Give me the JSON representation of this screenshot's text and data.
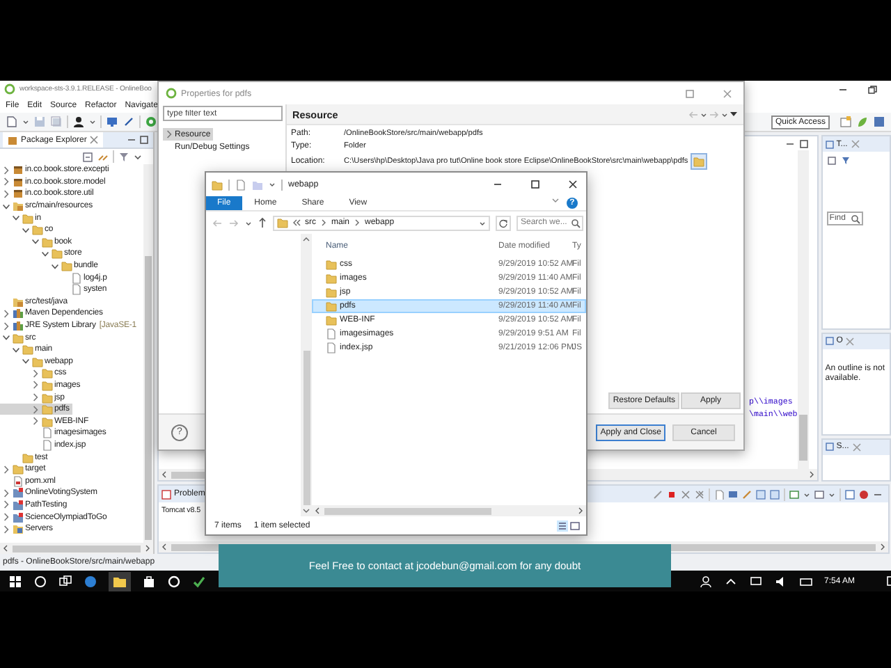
{
  "eclipse": {
    "title": "workspace-sts-3.9.1.RELEASE - OnlineBoo",
    "menu": [
      "File",
      "Edit",
      "Source",
      "Refactor",
      "Navigate"
    ],
    "quick_access": "Quick Access",
    "package_explorer": {
      "title": "Package Explorer",
      "tree": [
        {
          "label": "in.co.book.store.excepti",
          "kind": "package",
          "expanded": false,
          "selected": false
        },
        {
          "label": "in.co.book.store.model",
          "kind": "package",
          "expanded": false,
          "selected": false
        },
        {
          "label": "in.co.book.store.util",
          "kind": "package",
          "expanded": false,
          "selected": false
        },
        {
          "label": "src/main/resources",
          "kind": "source-folder",
          "expanded": true,
          "selected": false,
          "children": [
            {
              "label": "in",
              "kind": "folder",
              "expanded": true,
              "selected": false,
              "children": [
                {
                  "label": "co",
                  "kind": "folder",
                  "expanded": true,
                  "selected": false,
                  "children": [
                    {
                      "label": "book",
                      "kind": "folder",
                      "expanded": true,
                      "selected": false,
                      "children": [
                        {
                          "label": "store",
                          "kind": "folder",
                          "expanded": true,
                          "selected": false,
                          "children": [
                            {
                              "label": "bundle",
                              "kind": "folder",
                              "expanded": true,
                              "selected": false,
                              "children": [
                                {
                                  "label": "log4j.p",
                                  "kind": "file",
                                  "selected": false
                                },
                                {
                                  "label": "systen",
                                  "kind": "file",
                                  "selected": false
                                }
                              ]
                            }
                          ]
                        }
                      ]
                    }
                  ]
                }
              ]
            }
          ]
        },
        {
          "label": "src/test/java",
          "kind": "source-folder",
          "selected": false
        },
        {
          "label": "Maven Dependencies",
          "kind": "library",
          "expanded": false,
          "selected": false
        },
        {
          "label": "JRE System Library",
          "decoration": "[JavaSE-1",
          "kind": "library",
          "expanded": false,
          "selected": false
        },
        {
          "label": "src",
          "kind": "folder",
          "expanded": true,
          "selected": false,
          "children": [
            {
              "label": "main",
              "kind": "folder",
              "expanded": true,
              "selected": false,
              "children": [
                {
                  "label": "webapp",
                  "kind": "folder",
                  "expanded": true,
                  "selected": false,
                  "children": [
                    {
                      "label": "css",
                      "kind": "folder",
                      "expanded": false,
                      "selected": false
                    },
                    {
                      "label": "images",
                      "kind": "folder",
                      "expanded": false,
                      "selected": false
                    },
                    {
                      "label": "jsp",
                      "kind": "folder",
                      "expanded": false,
                      "selected": false
                    },
                    {
                      "label": "pdfs",
                      "kind": "folder",
                      "expanded": false,
                      "selected": true
                    },
                    {
                      "label": "WEB-INF",
                      "kind": "folder",
                      "expanded": false,
                      "selected": false
                    },
                    {
                      "label": "imagesimages",
                      "kind": "file",
                      "selected": false
                    },
                    {
                      "label": "index.jsp",
                      "kind": "file",
                      "selected": false
                    }
                  ]
                }
              ]
            },
            {
              "label": "test",
              "kind": "folder",
              "selected": false
            }
          ]
        },
        {
          "label": "target",
          "kind": "folder",
          "expanded": false,
          "selected": false
        },
        {
          "label": "pom.xml",
          "kind": "xml",
          "selected": false
        },
        {
          "label": "OnlineVotingSystem",
          "kind": "project",
          "expanded": false,
          "selected": false
        },
        {
          "label": "PathTesting",
          "kind": "project",
          "expanded": false,
          "selected": false
        },
        {
          "label": "ScienceOlympiadToGo",
          "kind": "project",
          "expanded": false,
          "selected": false
        },
        {
          "label": "Servers",
          "kind": "server-folder",
          "expanded": false,
          "selected": false
        }
      ]
    },
    "right_panels": [
      {
        "title": "T..."
      },
      {
        "title": "O"
      },
      {
        "title": "S..."
      }
    ],
    "find_field": {
      "placeholder": "Find"
    },
    "outline_message": "An outline is not available.",
    "code_lines": [
      "p\\\\images",
      "\\main\\\\web"
    ],
    "bottom_panel": {
      "tab": "Problem",
      "line": "Tomcat v8.5"
    },
    "status_bar": "pdfs - OnlineBookStore/src/main/webapp"
  },
  "properties_dialog": {
    "title": "Properties for pdfs",
    "filter": {
      "placeholder": "type filter text"
    },
    "pages": [
      {
        "label": "Resource",
        "expanded": false,
        "selected": true
      },
      {
        "label": "Run/Debug Settings",
        "selected": false
      }
    ],
    "heading": "Resource",
    "fields": [
      {
        "label": "Path:",
        "value": "/OnlineBookStore/src/main/webapp/pdfs"
      },
      {
        "label": "Type:",
        "value": "Folder"
      },
      {
        "label": "Location:",
        "value": "C:\\Users\\hp\\Desktop\\Java pro tut\\Online book store Eclipse\\OnlineBookStore\\src\\main\\webapp\\pdfs"
      }
    ],
    "page_buttons": [
      {
        "label": "Restore Defaults",
        "default": false
      },
      {
        "label": "Apply",
        "default": false
      }
    ],
    "help": "?",
    "buttons": [
      {
        "label": "Apply and Close",
        "default": true
      },
      {
        "label": "Cancel",
        "default": false
      }
    ]
  },
  "file_explorer": {
    "title": "webapp",
    "ribbon_tabs": [
      {
        "label": "File",
        "selected": true
      },
      {
        "label": "Home",
        "selected": false
      },
      {
        "label": "Share",
        "selected": false
      },
      {
        "label": "View",
        "selected": false
      }
    ],
    "help": "?",
    "path": [
      "src",
      "main",
      "webapp"
    ],
    "search": {
      "placeholder": "Search we..."
    },
    "columns": [
      "Name",
      "Date modified",
      "Ty"
    ],
    "rows": [
      {
        "name": "css",
        "kind": "folder",
        "date": "9/29/2019 10:52 AM",
        "type": "Fil",
        "selected": false
      },
      {
        "name": "images",
        "kind": "folder",
        "date": "9/29/2019 11:40 AM",
        "type": "Fil",
        "selected": false
      },
      {
        "name": "jsp",
        "kind": "folder",
        "date": "9/29/2019 10:52 AM",
        "type": "Fil",
        "selected": false
      },
      {
        "name": "pdfs",
        "kind": "folder",
        "date": "9/29/2019 11:40 AM",
        "type": "Fil",
        "selected": true
      },
      {
        "name": "WEB-INF",
        "kind": "folder",
        "date": "9/29/2019 10:52 AM",
        "type": "Fil",
        "selected": false
      },
      {
        "name": "imagesimages",
        "kind": "file",
        "date": "9/29/2019 9:51 AM",
        "type": "Fil",
        "selected": false
      },
      {
        "name": "index.jsp",
        "kind": "file",
        "date": "9/21/2019 12:06 PM",
        "type": "JS",
        "selected": false
      }
    ],
    "status": {
      "count": "7 items",
      "selection": "1 item selected"
    }
  },
  "banner": "Feel Free to contact at jcodebun@gmail.com for any doubt",
  "taskbar": {
    "time": "7:54 AM"
  }
}
